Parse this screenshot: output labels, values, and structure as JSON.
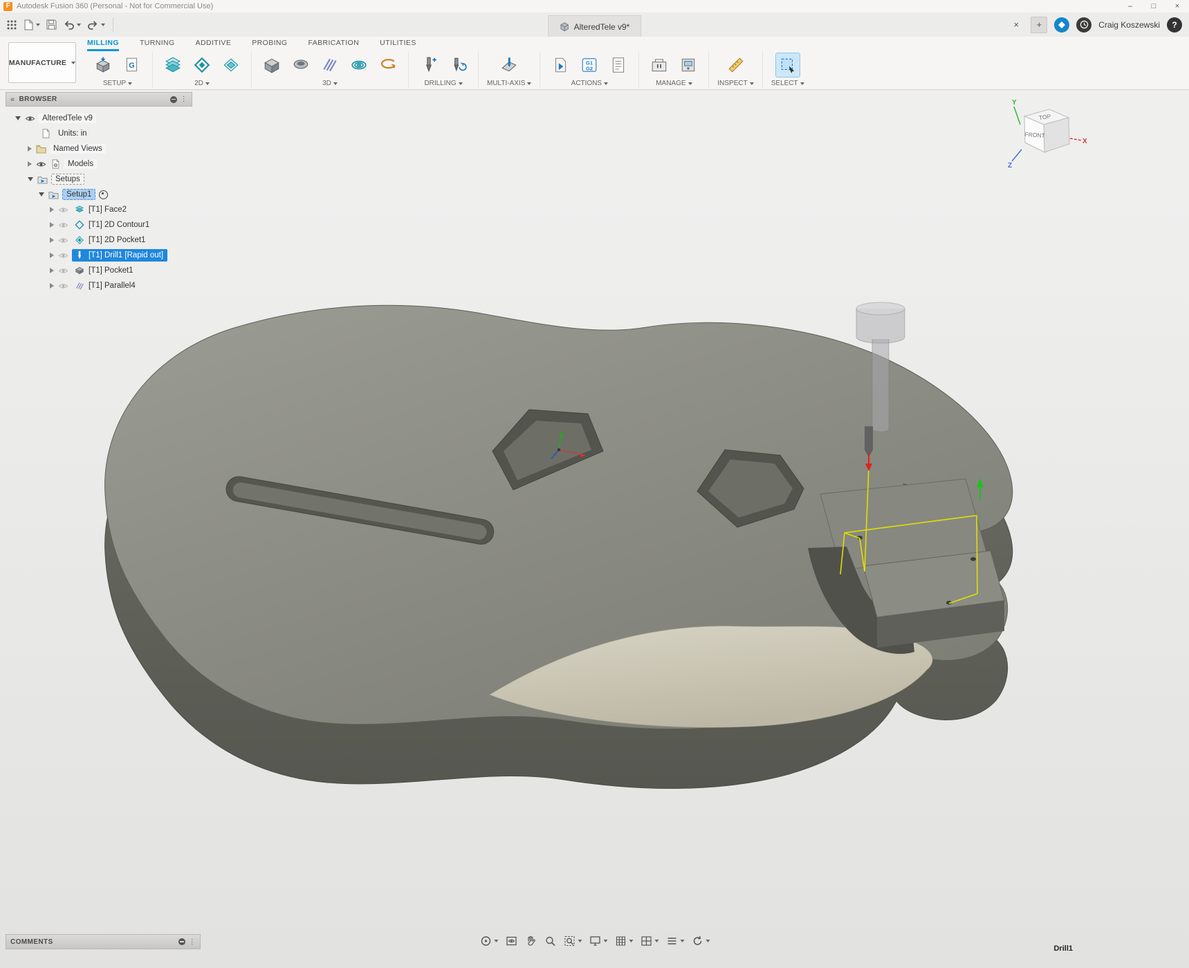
{
  "titlebar": {
    "app_title": "Autodesk Fusion 360 (Personal - Not for Commercial Use)"
  },
  "appbar": {
    "document_tab": "AlteredTele v9*",
    "user_name": "Craig Koszewski"
  },
  "ribbon": {
    "workspace_button": "MANUFACTURE",
    "tabs": [
      {
        "label": "MILLING",
        "active": true
      },
      {
        "label": "TURNING",
        "active": false
      },
      {
        "label": "ADDITIVE",
        "active": false
      },
      {
        "label": "PROBING",
        "active": false
      },
      {
        "label": "FABRICATION",
        "active": false
      },
      {
        "label": "UTILITIES",
        "active": false
      }
    ],
    "groups": [
      {
        "label": "SETUP"
      },
      {
        "label": "2D"
      },
      {
        "label": "3D"
      },
      {
        "label": "DRILLING"
      },
      {
        "label": "MULTI-AXIS"
      },
      {
        "label": "ACTIONS"
      },
      {
        "label": "MANAGE"
      },
      {
        "label": "INSPECT"
      },
      {
        "label": "SELECT"
      }
    ]
  },
  "browser": {
    "title": "BROWSER",
    "tree": [
      {
        "label": "AlteredTele v9",
        "icon": "document",
        "visible": true
      },
      {
        "label": "Units: in",
        "icon": "units-document"
      },
      {
        "label": "Named Views",
        "icon": "folder"
      },
      {
        "label": "Models",
        "icon": "bodies",
        "visible": true
      },
      {
        "label": "Setups",
        "icon": "setups-folder"
      },
      {
        "label": "Setup1",
        "icon": "setup",
        "selected": true,
        "active_setup": true
      },
      {
        "label": "[T1] Face2",
        "icon": "face-operation",
        "visible": false
      },
      {
        "label": "[T1] 2D Contour1",
        "icon": "2d-contour-operation",
        "visible": false
      },
      {
        "label": "[T1] 2D Pocket1",
        "icon": "2d-pocket-operation",
        "visible": false
      },
      {
        "label": "[T1] Drill1 [Rapid out]",
        "icon": "drill-operation",
        "selected": true,
        "visible": false
      },
      {
        "label": "[T1] Pocket1",
        "icon": "pocket-operation",
        "visible": false
      },
      {
        "label": "[T1] Parallel4",
        "icon": "parallel-operation",
        "visible": false
      }
    ]
  },
  "viewcube": {
    "top": "TOP",
    "front": "FRONT",
    "axis_x": "X",
    "axis_y": "Y",
    "axis_z": "Z"
  },
  "comments": {
    "label": "COMMENTS"
  },
  "canvas": {
    "active_operation": "Drill1"
  },
  "icons": {
    "logo": "F",
    "minimize": "–",
    "maximize": "□",
    "close": "×",
    "add": "+",
    "help": "?",
    "collapse": "«",
    "overflow": "⋮",
    "g_label": "G",
    "g1": "G1",
    "g2": "G2"
  },
  "colors": {
    "accent_blue": "#0696d7",
    "selection_blue": "#1f87dd",
    "fusion_orange": "#f7901e",
    "body_gray": "#8b8c83",
    "body_side_gray": "#65665e",
    "stock_cream": "#cdc8b5",
    "toolpath_yellow": "#e6e600",
    "canvas_bg": "#e9e9e8"
  }
}
